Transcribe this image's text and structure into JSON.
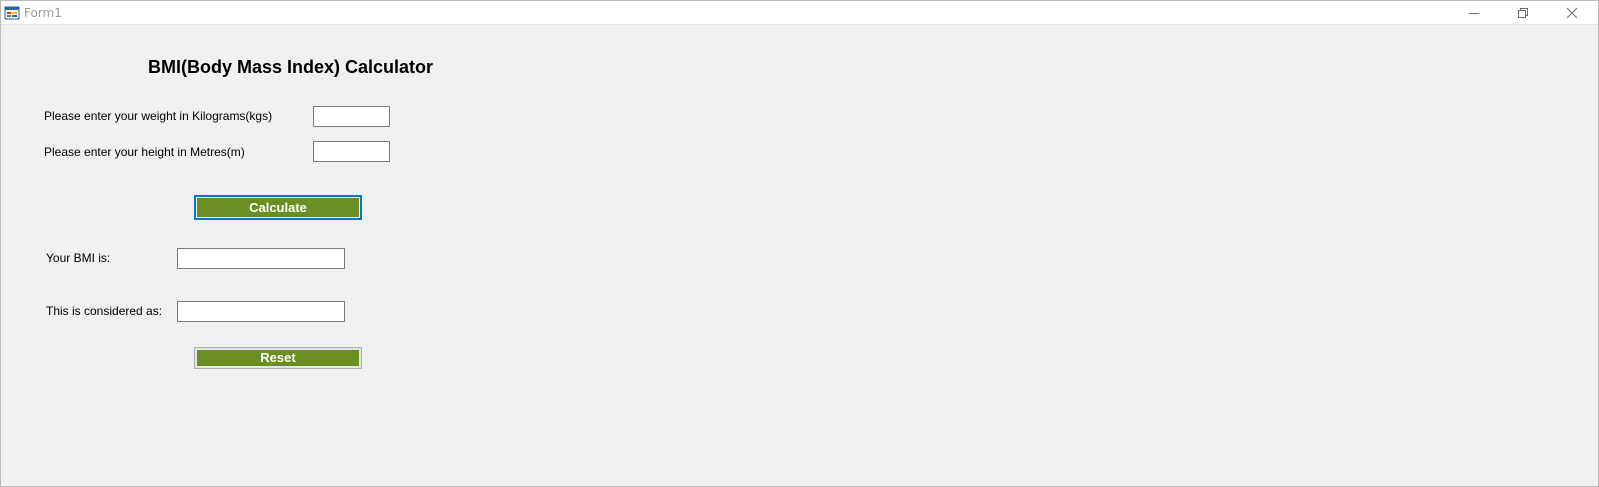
{
  "window": {
    "title": "Form1"
  },
  "form": {
    "heading": "BMI(Body Mass Index) Calculator",
    "weight_label": "Please enter your weight in Kilograms(kgs)",
    "weight_value": "",
    "height_label": "Please enter your height in Metres(m)",
    "height_value": "",
    "calculate_label": "Calculate",
    "bmi_label": "Your BMI is:",
    "bmi_value": "",
    "category_label": "This is considered as:",
    "category_value": "",
    "reset_label": "Reset"
  },
  "colors": {
    "button_green": "#6b8e23",
    "focus_border": "#0078d7",
    "form_background": "#f0f0f0"
  },
  "icons": {
    "app": "form-app-icon",
    "minimize": "minimize-icon",
    "maximize": "restore-icon",
    "close": "close-icon"
  }
}
